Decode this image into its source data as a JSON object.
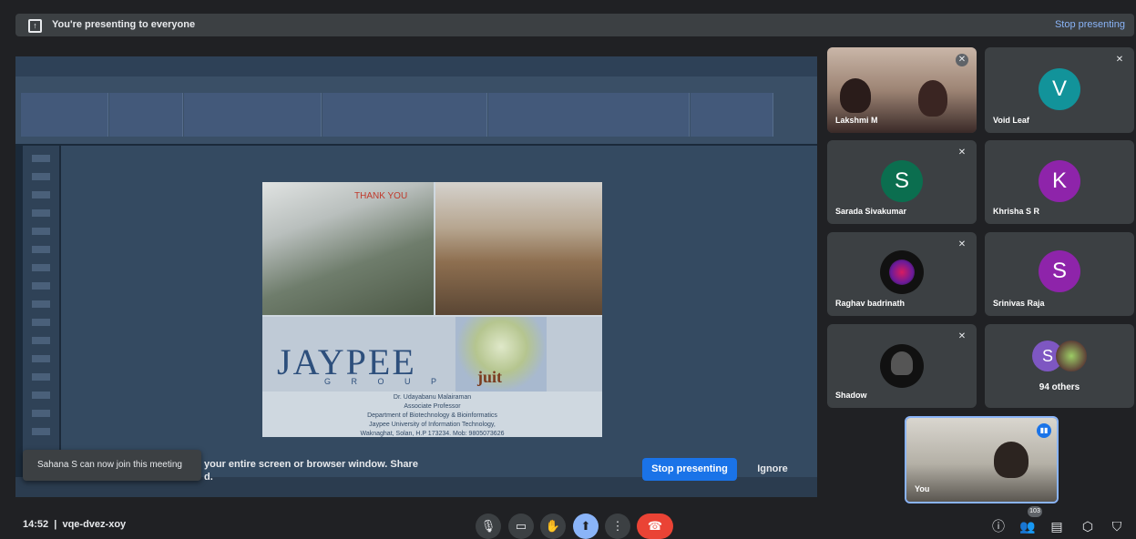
{
  "banner": {
    "text": "You're presenting to everyone",
    "stop_label": "Stop presenting"
  },
  "slide": {
    "thank_you": "THANK YOU",
    "logo_text": "JAYPEE",
    "logo_sub": "G R O U P",
    "juit_text": "juit",
    "credits": [
      "Dr. Udayabanu Malairaman",
      "Associate Professor",
      "Department of Biotechnology & Bioinformatics",
      "Jaypee University of Information Technology,",
      "Waknaghat, Solan, H.P 173234. Mob: 9805073626"
    ]
  },
  "infobar": {
    "line1": "your entire screen or browser window. Share",
    "line2": "d.",
    "stop_label": "Stop presenting",
    "ignore_label": "Ignore"
  },
  "toast": {
    "text": "Sahana S can now join this meeting"
  },
  "participants": [
    {
      "name": "Lakshmi M",
      "type": "video"
    },
    {
      "name": "Void Leaf",
      "initial": "V",
      "color": "#12939a"
    },
    {
      "name": "Sarada Sivakumar",
      "initial": "S",
      "color": "#0b6e4f"
    },
    {
      "name": "Khrisha S R",
      "initial": "K",
      "color": "#8e24aa"
    },
    {
      "name": "Raghav badrinath",
      "type": "image"
    },
    {
      "name": "Srinivas Raja",
      "initial": "S",
      "color": "#8e24aa"
    },
    {
      "name": "Shadow",
      "type": "image"
    },
    {
      "name": "94 others",
      "initial": "S",
      "color": "#7e57c2"
    }
  ],
  "self_tile": {
    "name": "You"
  },
  "meeting": {
    "time": "14:52",
    "code": "vqe-dvez-xoy",
    "participant_count": "103"
  },
  "colors": {
    "background": "#202124",
    "accent": "#1a73e8",
    "end_call": "#ea4335",
    "present_active": "#8ab4f8"
  }
}
